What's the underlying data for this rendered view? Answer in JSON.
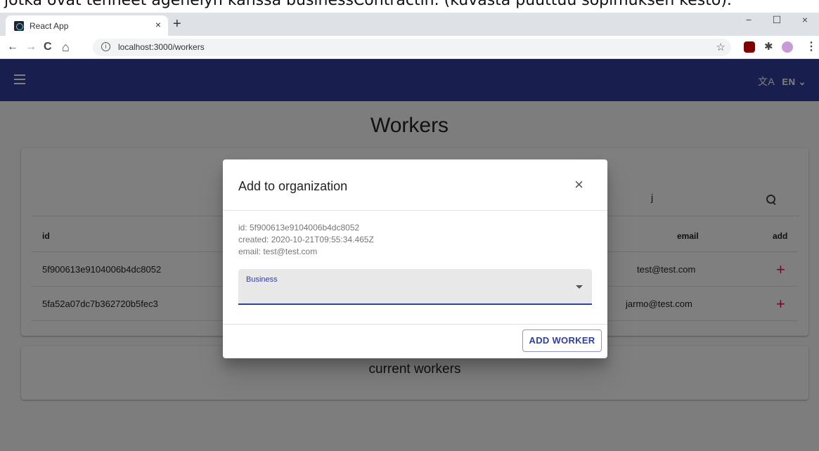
{
  "doc_caption": "jotka ovat tehneet agenelyn kanssa businessContractin. (kuvasta puuttuu sopimuksen kesto).",
  "browser": {
    "tab_title": "React App",
    "tab_close": "×",
    "new_tab": "+",
    "url": "localhost:3000/workers",
    "back": "←",
    "forward": "→",
    "reload": "C",
    "home": "⌂",
    "info": "i",
    "star": "☆",
    "minimize": "−",
    "maximize": "☐",
    "close": "×",
    "menu_dots": "⋮",
    "puzzle": "✱"
  },
  "appbar": {
    "lang_icon": "文A",
    "language": "EN",
    "lang_caret": "⌄"
  },
  "page": {
    "title": "Workers"
  },
  "search": {
    "value": "j"
  },
  "table": {
    "headers": {
      "id": "id",
      "email": "email",
      "add": "add"
    },
    "rows": [
      {
        "id": "5f900613e9104006b4dc8052",
        "email": "test@test.com",
        "add": "+"
      },
      {
        "id": "5fa52a07dc7b362720b5fec3",
        "email": "jarmo@test.com",
        "add": "+"
      }
    ]
  },
  "current_workers": {
    "title": "current workers"
  },
  "dialog": {
    "title": "Add to organization",
    "close": "×",
    "info_id": "id: 5f900613e9104006b4dc8052",
    "info_created": "created: 2020-10-21T09:55:34.465Z",
    "info_email": "email: test@test.com",
    "select_label": "Business",
    "select_value": "",
    "submit_label": "ADD WORKER"
  },
  "colors": {
    "appbar": "#303f9f",
    "accent_plus": "#d81b60"
  }
}
